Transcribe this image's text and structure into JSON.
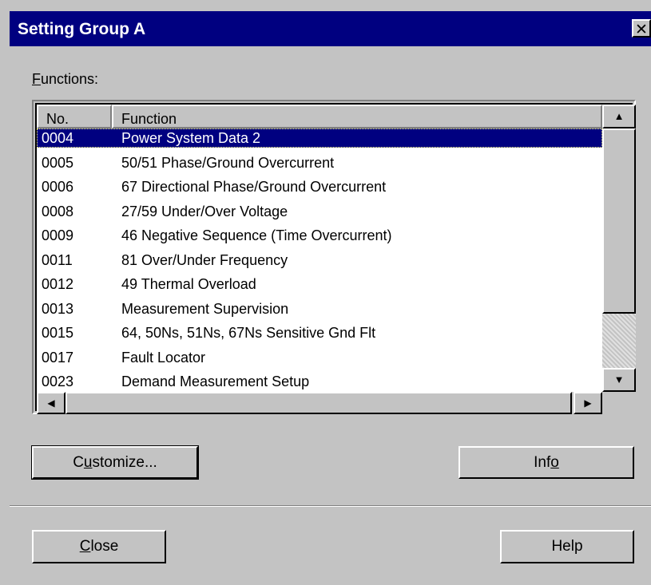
{
  "window": {
    "title": "Setting Group A",
    "close_glyph": "✕"
  },
  "functions_label": {
    "accel": "F",
    "rest": "unctions:"
  },
  "list": {
    "columns": [
      "No.",
      "Function"
    ],
    "selected_index": 0,
    "rows": [
      {
        "no": "0004",
        "function": "Power System Data 2"
      },
      {
        "no": "0005",
        "function": "50/51 Phase/Ground Overcurrent"
      },
      {
        "no": "0006",
        "function": "67 Directional Phase/Ground Overcurrent"
      },
      {
        "no": "0008",
        "function": "27/59 Under/Over Voltage"
      },
      {
        "no": "0009",
        "function": "46  Negative Sequence (Time Overcurrent)"
      },
      {
        "no": "0011",
        "function": "81 Over/Under Frequency"
      },
      {
        "no": "0012",
        "function": "49 Thermal Overload"
      },
      {
        "no": "0013",
        "function": "Measurement Supervision"
      },
      {
        "no": "0015",
        "function": "64, 50Ns, 51Ns, 67Ns Sensitive Gnd Flt"
      },
      {
        "no": "0017",
        "function": "Fault Locator"
      },
      {
        "no": "0023",
        "function": "Demand Measurement Setup"
      }
    ]
  },
  "buttons": {
    "customize": {
      "pre": "C",
      "accel": "u",
      "post": "stomize..."
    },
    "info": {
      "pre": "Inf",
      "accel": "o",
      "post": ""
    },
    "close": {
      "pre": "",
      "accel": "C",
      "post": "lose"
    },
    "help": {
      "label": "Help"
    }
  },
  "icons": {
    "scroll_up": "▲",
    "scroll_down": "▼",
    "scroll_left": "◀",
    "scroll_right": "▶"
  }
}
